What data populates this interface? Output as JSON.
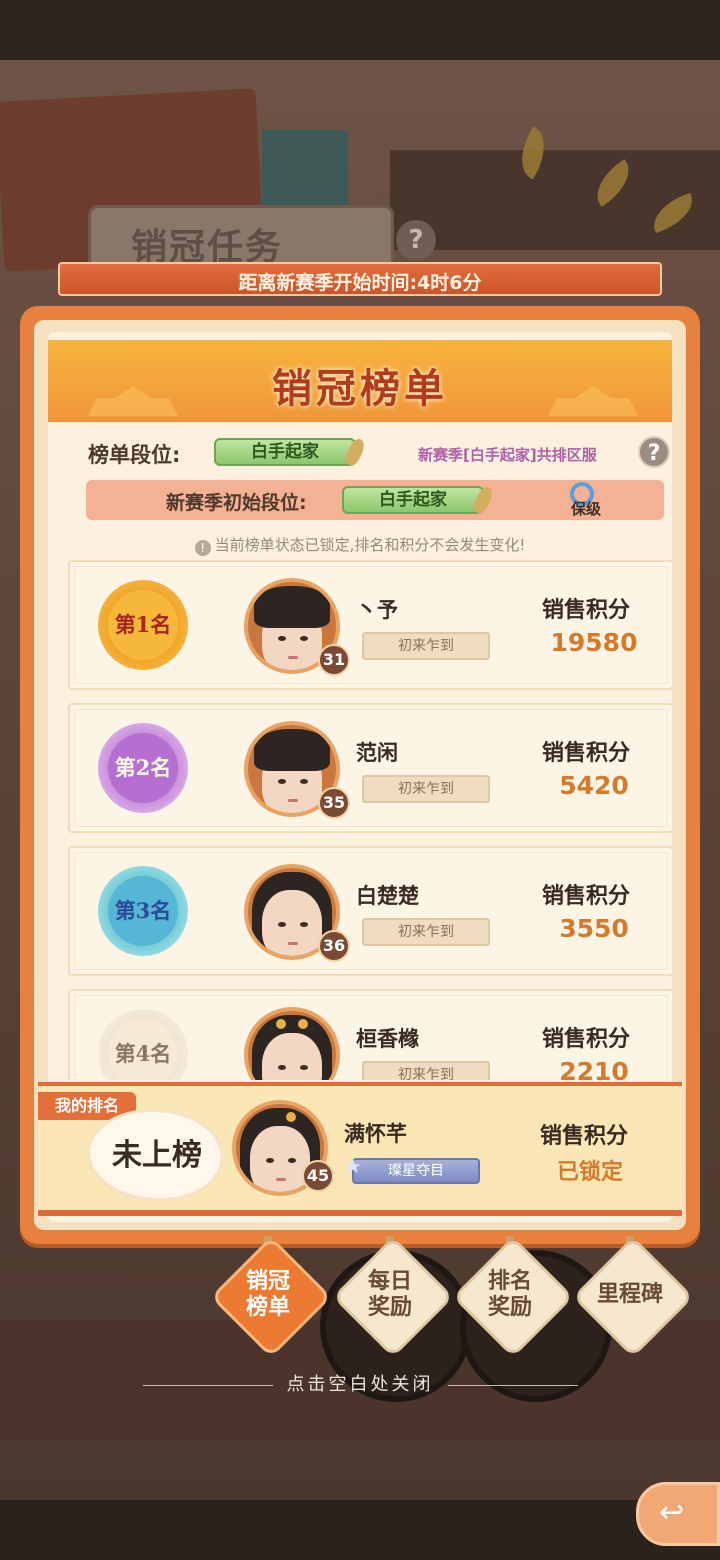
{
  "background": {
    "task_title": "销冠任务",
    "task_help_icon": "question-icon"
  },
  "countdown": {
    "text": "距离新赛季开始时间:4时6分"
  },
  "panel": {
    "title": "销冠榜单",
    "tier_label": "榜单段位:",
    "tier_value": "白手起家",
    "tier_note": "新赛季[白手起家]共排区服",
    "help_icon": "question-icon",
    "init_label": "新赛季初始段位:",
    "init_value": "白手起家",
    "protect_label": "保级",
    "lock_notice": "当前榜单状态已锁定,排名和积分不会发生变化!"
  },
  "ranks": [
    {
      "medal": "第1名",
      "name": "丶予",
      "level": "31",
      "title": "初来乍到",
      "score_label": "销售积分",
      "score": "19580"
    },
    {
      "medal": "第2名",
      "name": "范闲",
      "level": "35",
      "title": "初来乍到",
      "score_label": "销售积分",
      "score": "5420"
    },
    {
      "medal": "第3名",
      "name": "白楚楚",
      "level": "36",
      "title": "初来乍到",
      "score_label": "销售积分",
      "score": "3550"
    },
    {
      "medal": "第4名",
      "name": "桓香橼",
      "level": "",
      "title": "初来乍到",
      "score_label": "销售积分",
      "score": "2210"
    }
  ],
  "mine": {
    "tab": "我的排名",
    "status": "未上榜",
    "name": "满怀芊",
    "level": "45",
    "title": "璨星夺目",
    "score_label": "销售积分",
    "score": "已锁定"
  },
  "tabs": [
    {
      "label": "销冠榜单",
      "active": true
    },
    {
      "label": "每日奖励",
      "active": false
    },
    {
      "label": "排名奖励",
      "active": false
    },
    {
      "label": "里程碑",
      "active": false
    }
  ],
  "close_hint": "点击空白处关闭",
  "colors": {
    "accent": "#e9813e",
    "score": "#d37a2c",
    "active_tab": "#ec7a33"
  }
}
